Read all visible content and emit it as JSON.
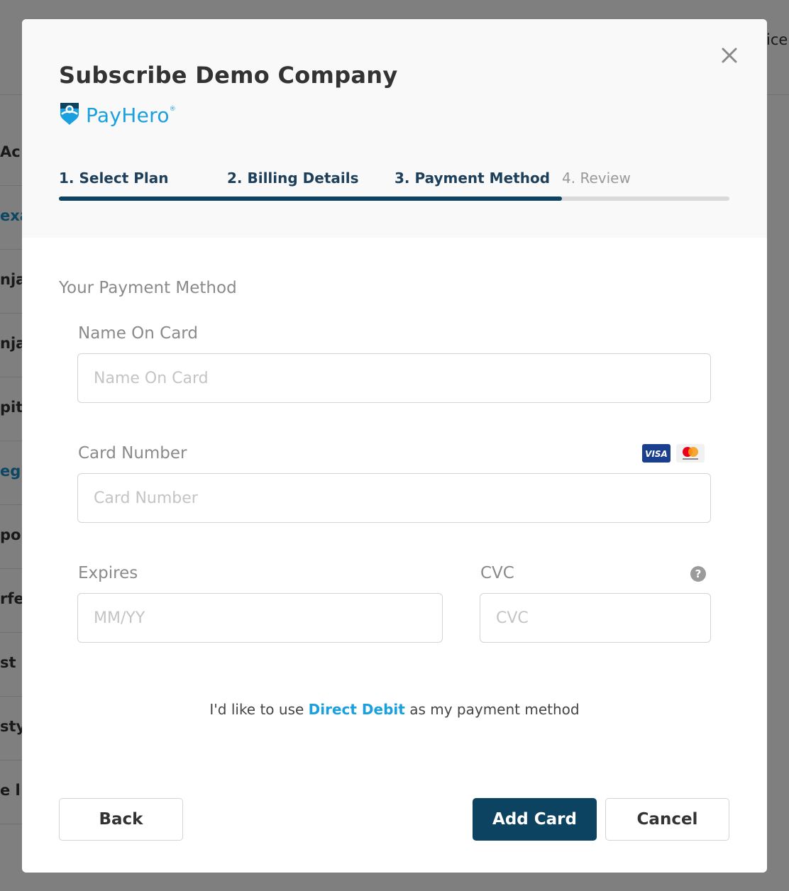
{
  "background": {
    "top_right_text": "ice",
    "rows": [
      "Ac",
      "exa",
      "nja",
      "nja",
      "pit",
      "eg'",
      "po",
      "rfe",
      "st",
      "sty",
      "e l"
    ]
  },
  "modal": {
    "title": "Subscribe Demo Company",
    "close_icon": "close-icon",
    "logo": {
      "text": "PayHero",
      "reg": "®",
      "brand_color": "#1aa0de"
    },
    "steps": [
      {
        "label": "1. Select Plan",
        "state": "complete"
      },
      {
        "label": "2. Billing Details",
        "state": "complete"
      },
      {
        "label": "3. Payment Method",
        "state": "active"
      },
      {
        "label": "4. Review",
        "state": "inactive"
      }
    ],
    "progress": 0.75,
    "progress_color": "#0b4361",
    "section_title": "Your Payment Method",
    "name_on_card": {
      "label": "Name On Card",
      "placeholder": "Name On Card",
      "value": ""
    },
    "card_number": {
      "label": "Card Number",
      "placeholder": "Card Number",
      "value": "",
      "card_icons": [
        "visa-icon",
        "mastercard-icon"
      ]
    },
    "expires": {
      "label": "Expires",
      "placeholder": "MM/YY",
      "value": ""
    },
    "cvc": {
      "label": "CVC",
      "placeholder": "CVC",
      "value": "",
      "help_icon": "?"
    },
    "direct_debit": {
      "prefix": "I'd like to use ",
      "link": "Direct Debit",
      "suffix": " as my payment method"
    },
    "buttons": {
      "back": "Back",
      "add_card": "Add Card",
      "cancel": "Cancel"
    }
  }
}
